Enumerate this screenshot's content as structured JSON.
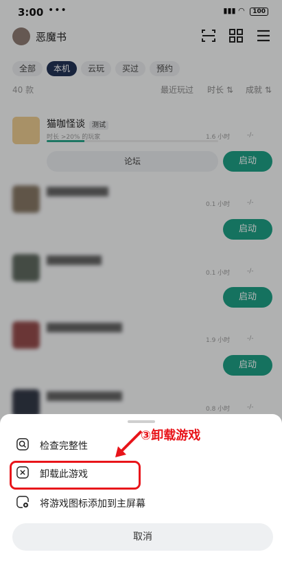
{
  "status": {
    "time": "3:00",
    "dots": "•••",
    "battery": "100"
  },
  "header": {
    "app_name": "恶魔书"
  },
  "filter": {
    "tabs": [
      {
        "label": "全部",
        "active": false
      },
      {
        "label": "本机",
        "active": true
      },
      {
        "label": "云玩",
        "active": false
      },
      {
        "label": "买过",
        "active": false
      },
      {
        "label": "预约",
        "active": false
      }
    ],
    "count": "40 款",
    "sort": [
      "最近玩过",
      "时长 ⇅",
      "成就 ⇅"
    ]
  },
  "games": [
    {
      "name": "猫咖怪谈",
      "tag": "测试",
      "sub": "时长 >20% 的玩家",
      "time": "1.6 小时",
      "dash": "-/-",
      "forum": "论坛",
      "launch": "启动",
      "progress": 0.22
    },
    {
      "time": "0.1 小时",
      "dash": "-/-",
      "launch": "启动"
    },
    {
      "time": "0.1 小时",
      "dash": "-/-",
      "launch": "启动"
    },
    {
      "time": "1.9 小时",
      "dash": "-/-",
      "launch": "启动"
    },
    {
      "time": "0.8 小时",
      "dash": "-/-"
    }
  ],
  "sheet": {
    "items": [
      {
        "label": "检查完整性",
        "icon": "search-icon"
      },
      {
        "label": "卸载此游戏",
        "icon": "uninstall-icon"
      },
      {
        "label": "将游戏图标添加到主屏幕",
        "icon": "add-to-home-icon"
      }
    ],
    "cancel": "取消"
  },
  "annotation": "③卸载游戏",
  "colors": {
    "accent": "#1e9f84",
    "highlight": "#e8141a",
    "tab_active": "#223255"
  }
}
